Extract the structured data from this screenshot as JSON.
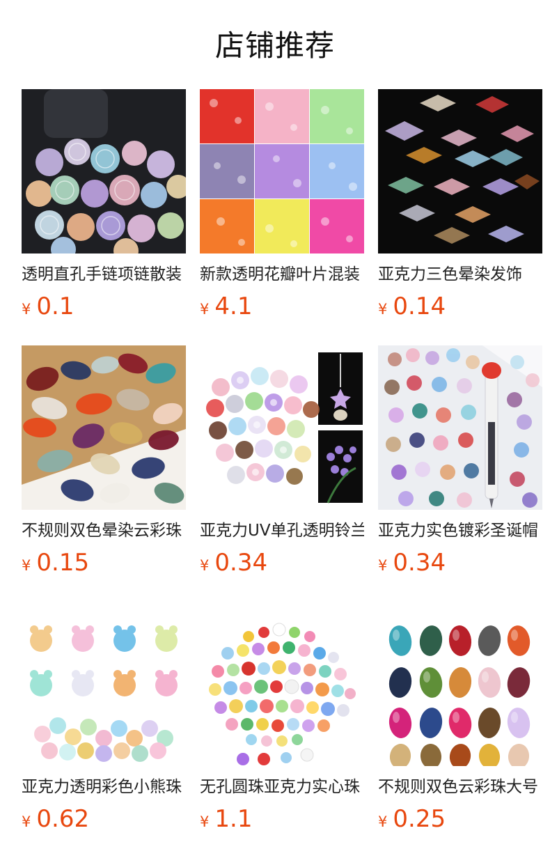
{
  "page": {
    "title": "店铺推荐"
  },
  "products": [
    {
      "name": "透明直孔手链项链散装",
      "currency": "¥",
      "price": "0.1",
      "image": "clear-carved-beads"
    },
    {
      "name": "新款透明花瓣叶片混装",
      "currency": "¥",
      "price": "4.1",
      "image": "petal-leaf-mix-grid"
    },
    {
      "name": "亚克力三色晕染发饰",
      "currency": "¥",
      "price": "0.14",
      "image": "gradient-bow-beads"
    },
    {
      "name": "不规则双色晕染云彩珠",
      "currency": "¥",
      "price": "0.15",
      "image": "irregular-marble-beads"
    },
    {
      "name": "亚克力UV单孔透明铃兰花",
      "currency": "¥",
      "price": "0.34",
      "image": "lily-of-valley-caps"
    },
    {
      "name": "亚克力实色镀彩圣诞帽",
      "currency": "¥",
      "price": "0.34",
      "image": "plated-shell-beads"
    },
    {
      "name": "亚克力透明彩色小熊珠",
      "currency": "¥",
      "price": "0.62",
      "image": "clear-bear-beads"
    },
    {
      "name": "无孔圆珠亚克力实心珠",
      "currency": "¥",
      "price": "1.1",
      "image": "solid-round-beads"
    },
    {
      "name": "不规则双色云彩珠大号",
      "currency": "¥",
      "price": "0.25",
      "image": "cloud-nugget-beads"
    }
  ],
  "colors": {
    "price": "#e8470e",
    "title": "#111111",
    "name": "#222222"
  }
}
